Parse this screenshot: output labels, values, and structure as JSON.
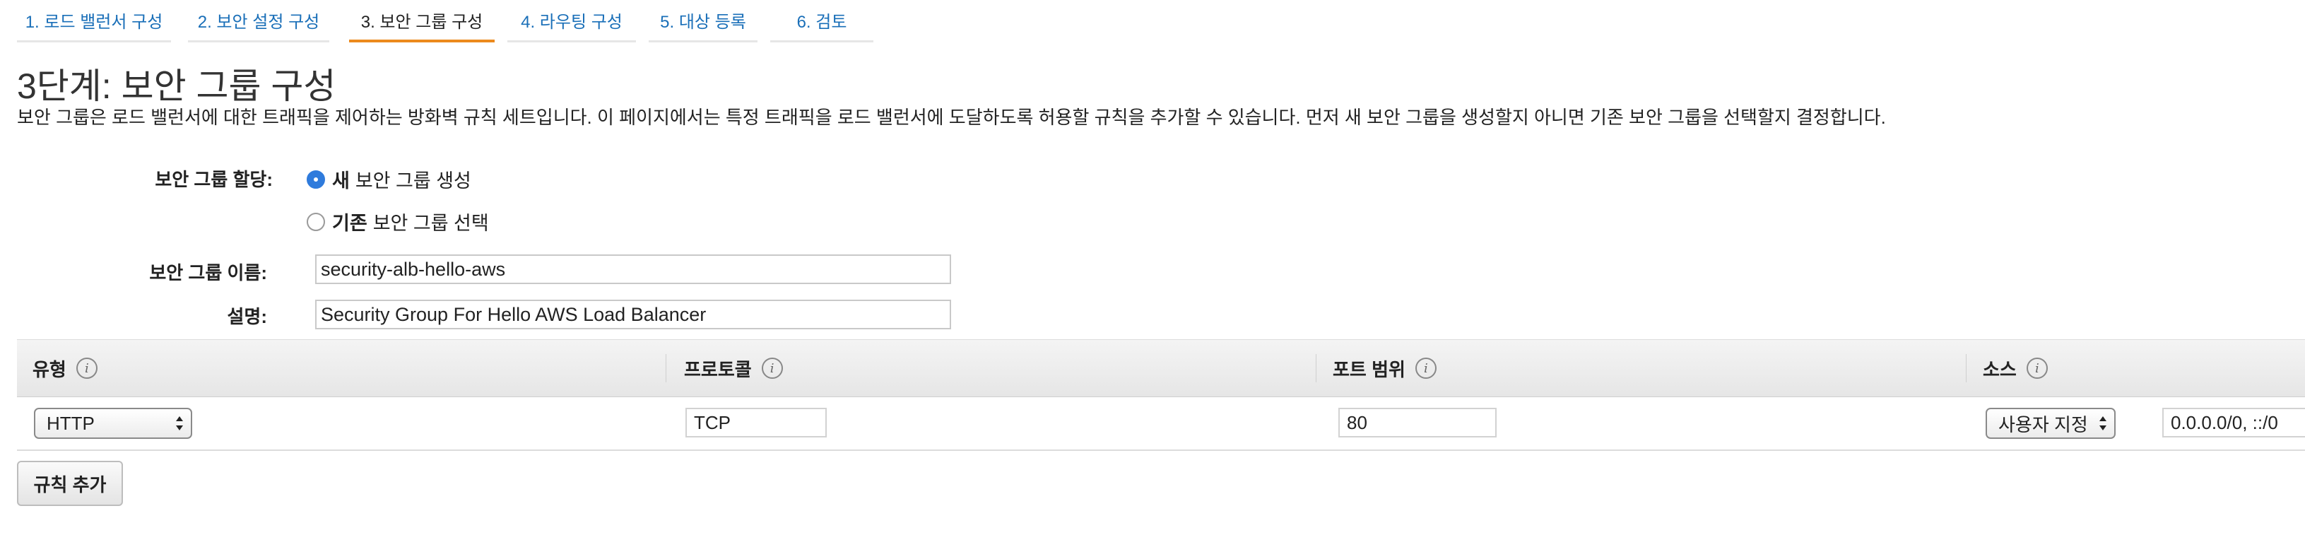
{
  "steps": [
    {
      "label": "1. 로드 밸런서 구성"
    },
    {
      "label": "2. 보안 설정 구성"
    },
    {
      "label": "3. 보안 그룹 구성",
      "active": true
    },
    {
      "label": "4. 라우팅 구성"
    },
    {
      "label": "5. 대상 등록"
    },
    {
      "label": "6. 검토"
    }
  ],
  "page": {
    "title": "3단계: 보안 그룹 구성",
    "description": "보안 그룹은 로드 밸런서에 대한 트래픽을 제어하는 방화벽 규칙 세트입니다. 이 페이지에서는 특정 트래픽을 로드 밸런서에 도달하도록 허용할 규칙을 추가할 수 있습니다. 먼저 새 보안 그룹을 생성할지 아니면 기존 보안 그룹을 선택할지 결정합니다."
  },
  "form": {
    "assign_label": "보안 그룹 할당:",
    "option_new_bold": "새",
    "option_new_rest": "보안 그룹 생성",
    "option_existing_bold": "기존",
    "option_existing_rest": "보안 그룹 선택",
    "selected_option": "new",
    "name_label": "보안 그룹 이름:",
    "name_value": "security-alb-hello-aws",
    "desc_label": "설명:",
    "desc_value": "Security Group For Hello AWS Load Balancer"
  },
  "rules_table": {
    "headers": [
      "유형",
      "프로토콜",
      "포트 범위",
      "소스"
    ],
    "info_glyph": "i",
    "rows": [
      {
        "type": "HTTP",
        "protocol": "TCP",
        "port_range": "80",
        "source_mode": "사용자 지정",
        "source_value": "0.0.0.0/0, ::/0"
      }
    ]
  },
  "add_rule_label": "규칙 추가",
  "colors": {
    "link": "#1a6fb8",
    "active_tab_underline": "#ec8a1d",
    "radio_checked": "#2f7bdc"
  }
}
